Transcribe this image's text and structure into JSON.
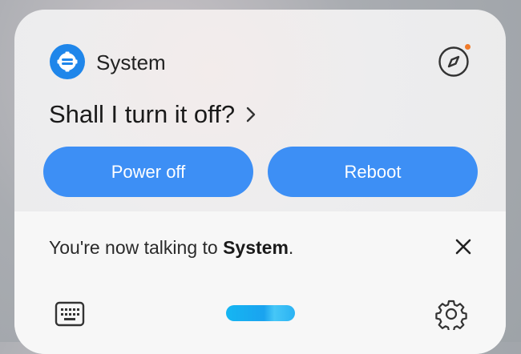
{
  "header": {
    "app_name": "System",
    "question": "Shall I turn it off?"
  },
  "actions": {
    "power_off_label": "Power off",
    "reboot_label": "Reboot"
  },
  "status": {
    "prefix": "You're now talking to ",
    "assistant_name": "System",
    "suffix": "."
  },
  "icons": {
    "app": "system-gear-icon",
    "explore": "compass-icon",
    "dismiss": "close-icon",
    "input_mode": "keyboard-icon",
    "voice": "voice-pill-icon",
    "settings": "gear-icon"
  },
  "colors": {
    "accent": "#3d8ff5",
    "app_icon": "#1f86ea",
    "notification_dot": "#f07a2a",
    "voice_pill": "#15b6f2"
  }
}
